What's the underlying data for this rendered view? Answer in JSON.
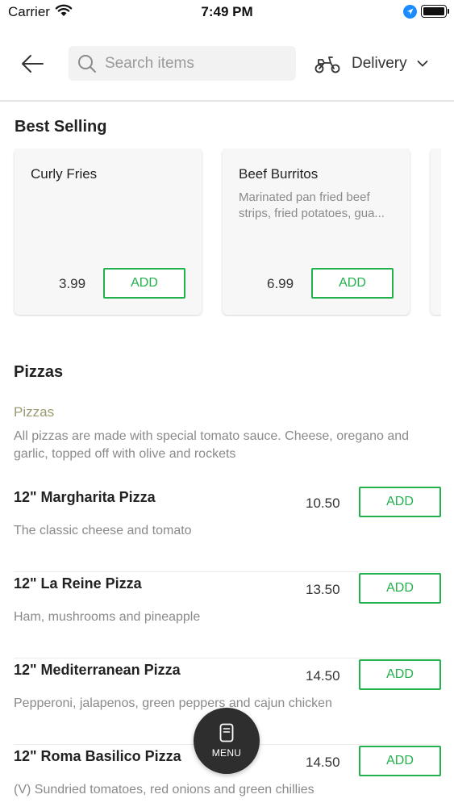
{
  "status_bar": {
    "carrier": "Carrier",
    "time": "7:49 PM",
    "icons": [
      "wifi-icon",
      "location-arrow-icon",
      "battery-icon"
    ]
  },
  "header": {
    "back_icon": "arrow-left-icon",
    "search": {
      "placeholder": "Search items",
      "value": "",
      "icon": "search-icon"
    },
    "delivery": {
      "label": "Delivery",
      "icon": "scooter-icon",
      "chevron": "chevron-down-icon"
    }
  },
  "best_selling": {
    "title": "Best Selling",
    "cards": [
      {
        "name": "Curly Fries",
        "desc_line1": "",
        "desc_line2": "",
        "price": "3.99",
        "add_label": "ADD"
      },
      {
        "name": "Beef Burritos",
        "desc_line1": "Marinated pan fried beef",
        "desc_line2": "strips, fried potatoes, gua...",
        "price": "6.99",
        "add_label": "ADD"
      }
    ]
  },
  "category": {
    "title": "Pizzas",
    "subtitle": "Pizzas",
    "description": "All pizzas are made with special tomato sauce. Cheese, oregano and garlic, topped off with olive and rockets",
    "items": [
      {
        "name": "12\" Margharita Pizza",
        "price": "10.50",
        "description": "The classic cheese and tomato",
        "add_label": "ADD"
      },
      {
        "name": "12\" La Reine Pizza",
        "price": "13.50",
        "description": "Ham, mushrooms and pineapple",
        "add_label": "ADD"
      },
      {
        "name": "12\" Mediterranean Pizza",
        "price": "14.50",
        "description": "Pepperoni, jalapenos, green peppers and cajun chicken",
        "add_label": "ADD"
      },
      {
        "name": "12\" Roma Basilico Pizza",
        "price": "14.50",
        "description": "(V) Sundried tomatoes, red onions and green chillies",
        "add_label": "ADD"
      }
    ]
  },
  "menu_button": {
    "label": "MENU",
    "icon": "menu-book-icon"
  },
  "colors": {
    "accent": "#22b14c",
    "fab": "#2e2e2e",
    "subtitle": "#9a9a70"
  }
}
